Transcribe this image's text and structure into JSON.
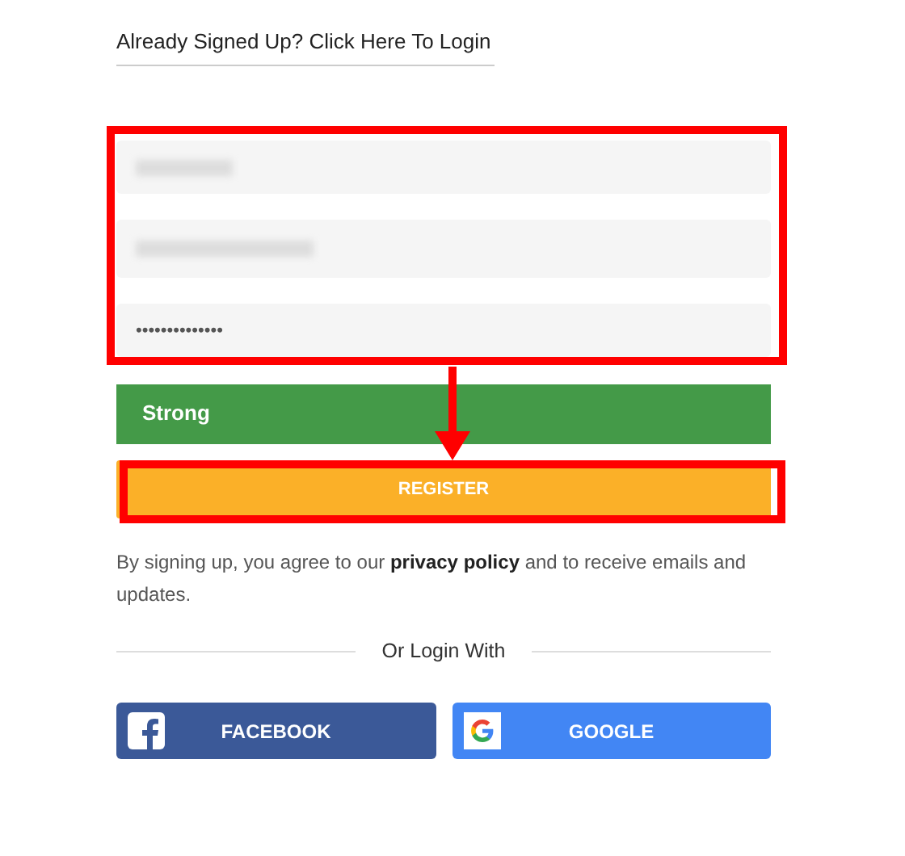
{
  "login_link": "Already Signed Up? Click Here To Login",
  "fields": [
    {
      "kind": "blurred"
    },
    {
      "kind": "blurred"
    },
    {
      "kind": "password",
      "value": "••••••••••••••"
    }
  ],
  "strength_meter": {
    "label": "Strong",
    "level": 1
  },
  "register_button": "REGISTER",
  "terms": "By signing up, you agree to our **privacy policy** and to receive emails and updates.",
  "divider_label": "Or Login With",
  "social_buttons": [
    {
      "kind": "facebook",
      "label": "FACEBOOK"
    },
    {
      "kind": "google",
      "label": "GOOGLE"
    }
  ]
}
